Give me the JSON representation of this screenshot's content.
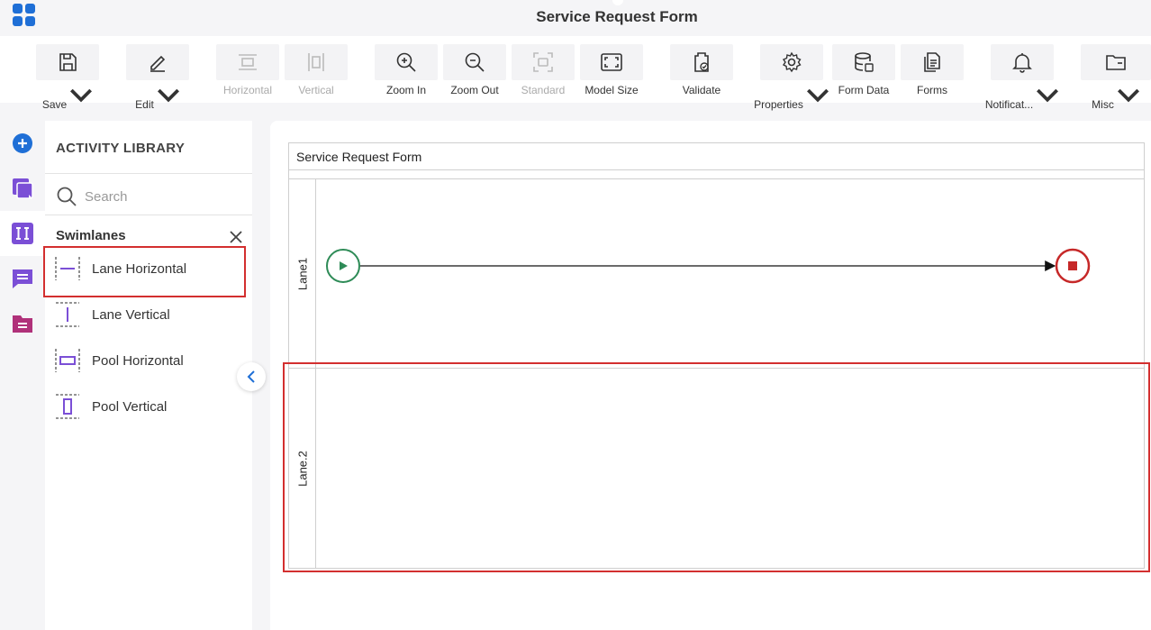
{
  "header": {
    "title": "Service Request Form"
  },
  "toolbar": {
    "save": "Save",
    "edit": "Edit",
    "horizontal": "Horizontal",
    "vertical": "Vertical",
    "zoom_in": "Zoom In",
    "zoom_out": "Zoom Out",
    "standard": "Standard",
    "model_size": "Model Size",
    "validate": "Validate",
    "properties": "Properties",
    "form_data": "Form Data",
    "forms": "Forms",
    "notifications": "Notificat...",
    "misc": "Misc"
  },
  "library": {
    "title": "ACTIVITY LIBRARY",
    "search_placeholder": "Search",
    "section": "Swimlanes",
    "items": [
      {
        "label": "Lane Horizontal",
        "icon": "lane-horizontal-icon"
      },
      {
        "label": "Lane Vertical",
        "icon": "lane-vertical-icon"
      },
      {
        "label": "Pool Horizontal",
        "icon": "pool-horizontal-icon"
      },
      {
        "label": "Pool Vertical",
        "icon": "pool-vertical-icon"
      }
    ]
  },
  "canvas": {
    "pool_title": "Service Request Form",
    "lanes": [
      "Lane1",
      "Lane.2"
    ]
  },
  "colors": {
    "accent": "#1f6fd6",
    "purple": "#7b4fd6",
    "highlight": "#d32f2f",
    "start": "#2e8b57",
    "end": "#c62828"
  }
}
